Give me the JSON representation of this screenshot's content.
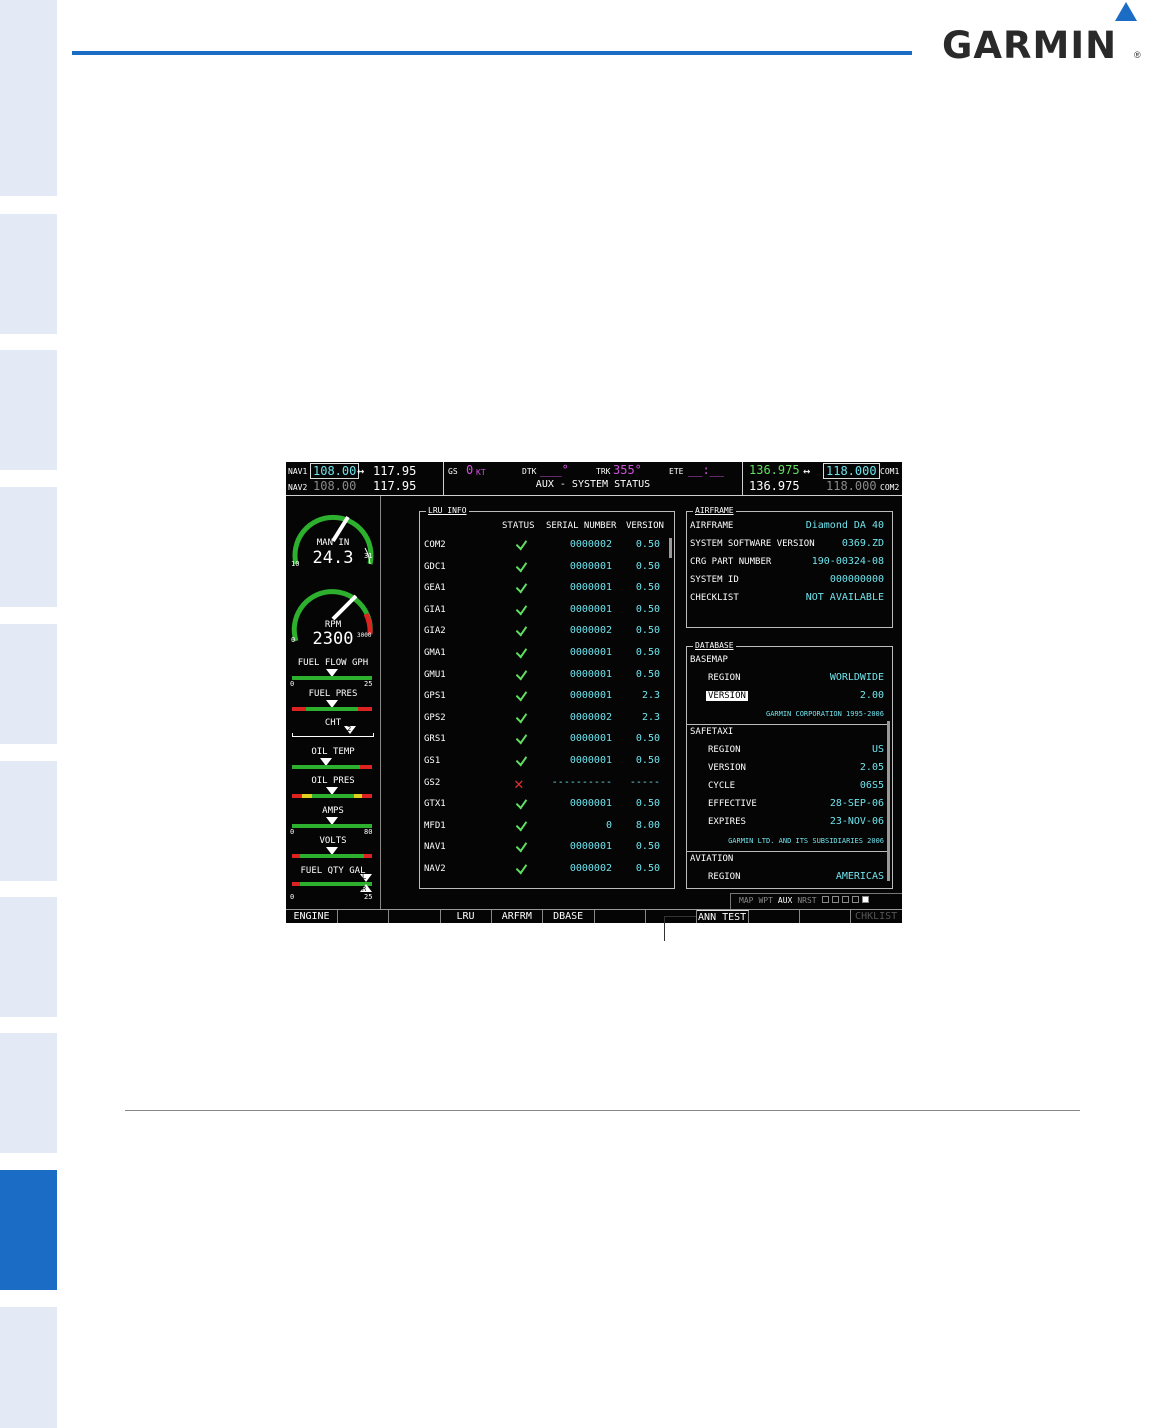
{
  "logo": {
    "text": "GARMIN",
    "reg": "®"
  },
  "mfd": {
    "topbar": {
      "nav1_label": "NAV1",
      "nav1_active": "108.00",
      "nav1_standby": "117.95",
      "nav2_label": "NAV2",
      "nav2_active": "108.00",
      "nav2_standby": "117.95",
      "gs_label": "GS",
      "gs_value": "0",
      "gs_unit": "KT",
      "dtk_label": "DTK",
      "dtk_value": "___°",
      "trk_label": "TRK",
      "trk_value": "355°",
      "ete_label": "ETE",
      "ete_value": "__:__",
      "page_title": "AUX - SYSTEM STATUS",
      "com1_active": "136.975",
      "com1_standby": "118.000",
      "com1_label": "COM1",
      "com2_active": "136.975",
      "com2_standby": "118.000",
      "com2_label": "COM2",
      "swap_glyph": "↔"
    },
    "eis": {
      "man_in_label": "MAN IN",
      "man_in_value": "24.3",
      "man_in_min": "10",
      "man_in_max": "31",
      "rpm_label": "RPM",
      "rpm_value": "2300",
      "rpm_min": "0",
      "rpm_max": "3000",
      "fuel_flow_label": "FUEL FLOW GPH",
      "fuel_flow_min": "0",
      "fuel_flow_max": "25",
      "fuel_pres_label": "FUEL PRES",
      "cht_label": "CHT",
      "cht_marker": "2",
      "oil_temp_label": "OIL TEMP",
      "oil_pres_label": "OIL PRES",
      "amps_label": "AMPS",
      "amps_min": "0",
      "amps_max": "80",
      "volts_label": "VOLTS",
      "fuel_qty_label": "FUEL QTY GAL",
      "fuel_qty_min": "0",
      "fuel_qty_max": "25",
      "fuel_qty_left": "L",
      "fuel_qty_right": "R"
    },
    "lru": {
      "title": "LRU INFO",
      "headers": {
        "status": "STATUS",
        "serial": "SERIAL NUMBER",
        "version": "VERSION"
      },
      "rows": [
        {
          "name": "COM2",
          "status": "ok",
          "serial": "0000002",
          "version": "0.50"
        },
        {
          "name": "GDC1",
          "status": "ok",
          "serial": "0000001",
          "version": "0.50"
        },
        {
          "name": "GEA1",
          "status": "ok",
          "serial": "0000001",
          "version": "0.50"
        },
        {
          "name": "GIA1",
          "status": "ok",
          "serial": "0000001",
          "version": "0.50"
        },
        {
          "name": "GIA2",
          "status": "ok",
          "serial": "0000002",
          "version": "0.50"
        },
        {
          "name": "GMA1",
          "status": "ok",
          "serial": "0000001",
          "version": "0.50"
        },
        {
          "name": "GMU1",
          "status": "ok",
          "serial": "0000001",
          "version": "0.50"
        },
        {
          "name": "GPS1",
          "status": "ok",
          "serial": "0000001",
          "version": "2.3"
        },
        {
          "name": "GPS2",
          "status": "ok",
          "serial": "0000002",
          "version": "2.3"
        },
        {
          "name": "GRS1",
          "status": "ok",
          "serial": "0000001",
          "version": "0.50"
        },
        {
          "name": "GS1",
          "status": "ok",
          "serial": "0000001",
          "version": "0.50"
        },
        {
          "name": "GS2",
          "status": "fail",
          "serial": "----------",
          "version": "-----"
        },
        {
          "name": "GTX1",
          "status": "ok",
          "serial": "0000001",
          "version": "0.50"
        },
        {
          "name": "MFD1",
          "status": "ok",
          "serial": "0",
          "version": "8.00"
        },
        {
          "name": "NAV1",
          "status": "ok",
          "serial": "0000001",
          "version": "0.50"
        },
        {
          "name": "NAV2",
          "status": "ok",
          "serial": "0000002",
          "version": "0.50"
        }
      ]
    },
    "airframe": {
      "title": "AIRFRAME",
      "rows": [
        {
          "label": "AIRFRAME",
          "value": "Diamond DA 40"
        },
        {
          "label": "SYSTEM SOFTWARE VERSION",
          "value": "0369.ZD"
        },
        {
          "label": "CRG PART NUMBER",
          "value": "190-00324-08"
        },
        {
          "label": "SYSTEM ID",
          "value": "000000000"
        },
        {
          "label": "CHECKLIST",
          "value": "NOT AVAILABLE"
        }
      ]
    },
    "database": {
      "title": "DATABASE",
      "basemap_label": "BASEMAP",
      "basemap_region_label": "REGION",
      "basemap_region": "WORLDWIDE",
      "basemap_version_label": "VERSION",
      "basemap_version": "2.00",
      "basemap_copyright": "GARMIN CORPORATION 1995-2006",
      "safetaxi_label": "SAFETAXI",
      "safetaxi_region_label": "REGION",
      "safetaxi_region": "US",
      "safetaxi_version_label": "VERSION",
      "safetaxi_version": "2.05",
      "safetaxi_cycle_label": "CYCLE",
      "safetaxi_cycle": "06S5",
      "safetaxi_effective_label": "EFFECTIVE",
      "safetaxi_effective": "28-SEP-06",
      "safetaxi_expires_label": "EXPIRES",
      "safetaxi_expires": "23-NOV-06",
      "safetaxi_copyright": "GARMIN LTD. AND ITS SUBSIDIARIES 2006",
      "aviation_label": "AVIATION",
      "aviation_region_label": "REGION",
      "aviation_region": "AMERICAS"
    },
    "page_group": {
      "items": [
        "MAP",
        "WPT",
        "AUX",
        "NRST"
      ],
      "active": "AUX"
    },
    "softkeys": [
      "ENGINE",
      "",
      "",
      "LRU",
      "ARFRM",
      "DBASE",
      "",
      "",
      "ANN TEST",
      "",
      "",
      "CHKLIST"
    ]
  }
}
